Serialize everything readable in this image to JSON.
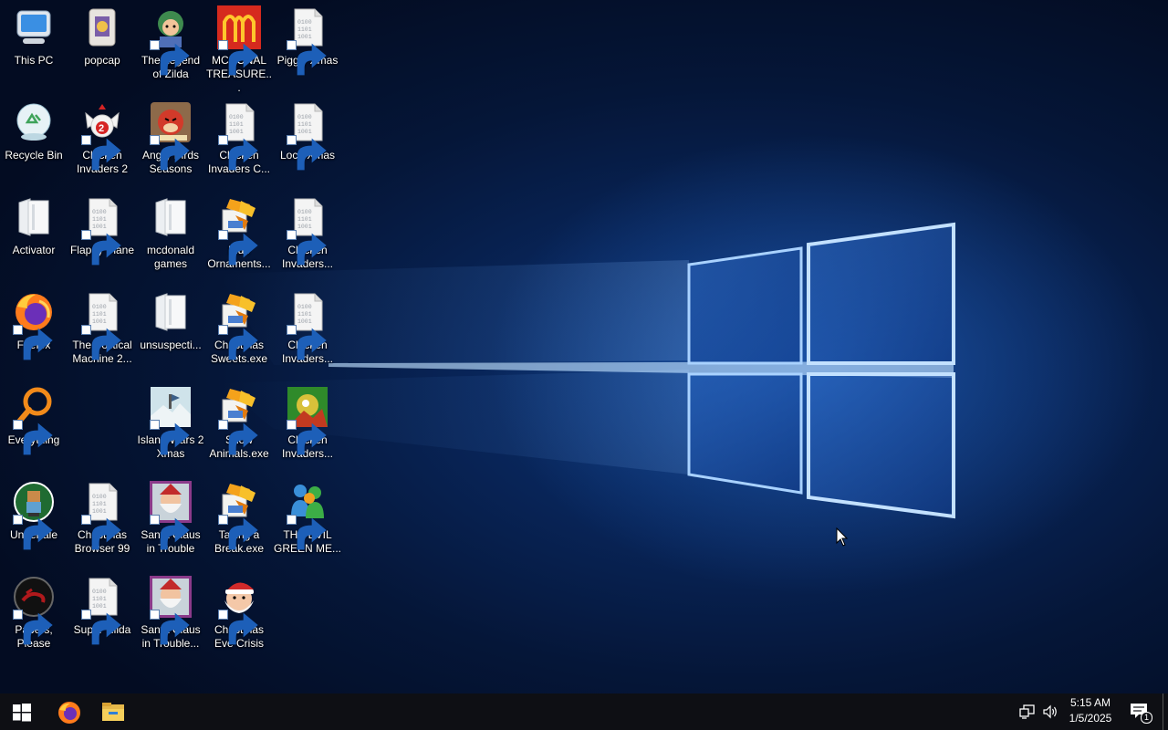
{
  "desktop": {
    "icons": [
      {
        "label": "This PC",
        "icon": "this-pc-icon",
        "shortcut": false
      },
      {
        "label": "popcap",
        "icon": "popcap-icon",
        "shortcut": false
      },
      {
        "label": "The Legend\nof Zilda",
        "icon": "legend-zilda-icon",
        "shortcut": true
      },
      {
        "label": "MCDONAL\nTREASURE...",
        "icon": "mcdonalds-icon",
        "shortcut": true
      },
      {
        "label": "Piggly Xmas",
        "icon": "binary-file-icon",
        "shortcut": true
      },
      {
        "label": "Recycle Bin",
        "icon": "recycle-bin-icon",
        "shortcut": false
      },
      {
        "label": "Chicken\nInvaders 2",
        "icon": "chicken-invaders-2-icon",
        "shortcut": true
      },
      {
        "label": "Angry Birds\nSeasons",
        "icon": "angry-birds-icon",
        "shortcut": true
      },
      {
        "label": "Chicken\nInvaders C...",
        "icon": "binary-file-icon",
        "shortcut": true
      },
      {
        "label": "Loco Xmas",
        "icon": "binary-file-icon",
        "shortcut": true
      },
      {
        "label": "Activator",
        "icon": "folder-icon",
        "shortcut": false
      },
      {
        "label": "Flappy Plane",
        "icon": "binary-file-icon",
        "shortcut": true
      },
      {
        "label": "mcdonald\ngames",
        "icon": "folder-icon",
        "shortcut": false
      },
      {
        "label": "Blue\nOrnaments...",
        "icon": "installer-icon",
        "shortcut": true
      },
      {
        "label": "Chicken\nInvaders...",
        "icon": "binary-file-icon",
        "shortcut": true
      },
      {
        "label": "Firefox",
        "icon": "firefox-icon",
        "shortcut": true
      },
      {
        "label": "The Political\nMachine 2...",
        "icon": "binary-file-icon",
        "shortcut": true
      },
      {
        "label": "unsuspecti...",
        "icon": "folder-icon",
        "shortcut": false
      },
      {
        "label": "Christmas\nSweets.exe",
        "icon": "installer-icon",
        "shortcut": true
      },
      {
        "label": "Chicken\nInvaders...",
        "icon": "binary-file-icon",
        "shortcut": true
      },
      {
        "label": "Everything",
        "icon": "everything-search-icon",
        "shortcut": true
      },
      {
        "label": "Island Wars 2\nXmas",
        "icon": "island-wars-icon",
        "shortcut": true
      },
      {
        "label": "Snow\nAnimals.exe",
        "icon": "installer-icon",
        "shortcut": true
      },
      {
        "label": "Chicken\nInvaders...",
        "icon": "chicken-invaders-4-icon",
        "shortcut": true
      },
      {
        "label": "Undertale",
        "icon": "undertale-icon",
        "shortcut": true
      },
      {
        "label": "Christmas\nBrowser 99",
        "icon": "binary-file-icon",
        "shortcut": true
      },
      {
        "label": "Santa Claus\nin Trouble",
        "icon": "santa-trouble-icon",
        "shortcut": true
      },
      {
        "label": "Taking a\nBreak.exe",
        "icon": "installer-icon",
        "shortcut": true
      },
      {
        "label": "THE EVIL\nGREEN ME...",
        "icon": "messenger-icon",
        "shortcut": true
      },
      {
        "label": "Papers,\nPlease",
        "icon": "papers-please-icon",
        "shortcut": true
      },
      {
        "label": "Super Hilda",
        "icon": "binary-file-icon",
        "shortcut": true
      },
      {
        "label": "Santa Claus\nin Trouble...",
        "icon": "santa-trouble-icon",
        "shortcut": true
      },
      {
        "label": "Christmas\nEve Crisis",
        "icon": "santa-face-icon",
        "shortcut": true
      }
    ]
  },
  "taskbar": {
    "start": "windows-logo-icon",
    "pinned": [
      {
        "name": "Firefox",
        "icon": "firefox-icon"
      },
      {
        "name": "File Explorer",
        "icon": "file-explorer-icon"
      }
    ],
    "tray": {
      "network": "network-icon",
      "volume": "volume-icon",
      "time": "5:15 AM",
      "date": "1/5/2025",
      "notifications_count": "1"
    }
  },
  "colors": {
    "taskbar": "#0e0f14",
    "wallpaper_dark": "#030c22",
    "wallpaper_glow": "#286ed2"
  }
}
